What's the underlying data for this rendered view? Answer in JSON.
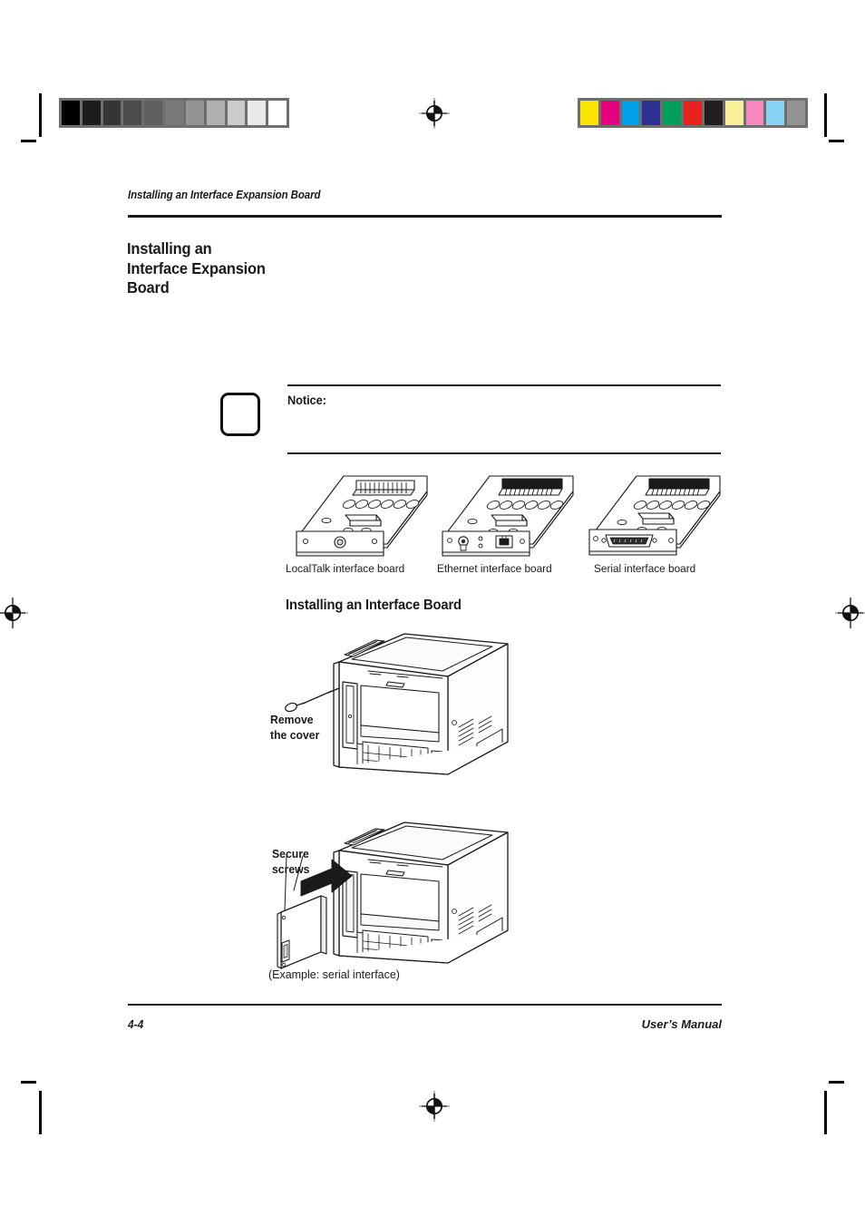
{
  "page": {
    "running_head": "Installing an Interface Expansion Board",
    "chapter_title": "Installing an Interface Expansion Board",
    "folio": "4-4",
    "manual_name": "User’s Manual"
  },
  "notice": {
    "label": "Notice:",
    "body": "",
    "icon": "notice-box-icon"
  },
  "boards": {
    "items": [
      {
        "caption": "LocalTalk interface board",
        "icon": "localtalk-board-illustration"
      },
      {
        "caption": "Ethernet interface board",
        "icon": "ethernet-board-illustration"
      },
      {
        "caption": "Serial interface board",
        "icon": "serial-board-illustration"
      }
    ]
  },
  "section": {
    "heading": "Installing an Interface Board"
  },
  "figures": {
    "step1": {
      "callout": "Remove\nthe cover",
      "callout_line1": "Remove",
      "callout_line2": "the cover",
      "icon": "printer-remove-cover-illustration"
    },
    "step2": {
      "callout_line1": "Secure",
      "callout_line2": "screws",
      "note": "(Example: serial interface)",
      "icon": "printer-insert-board-illustration"
    }
  },
  "calibration": {
    "gray_strip": {
      "name": "grayscale-step-wedge",
      "patches": [
        "#000000",
        "#1d1d1d",
        "#353535",
        "#4c4c4c",
        "#606060",
        "#787878",
        "#949494",
        "#b0b0b0",
        "#cbcbcb",
        "#e9e9e9",
        "#ffffff"
      ]
    },
    "color_strip": {
      "name": "color-control-bar",
      "patches": [
        "#fbe400",
        "#e4007f",
        "#00a0e9",
        "#2e3192",
        "#00a05a",
        "#e8231f",
        "#231f20",
        "#faf09a",
        "#f589bd",
        "#86d3f5",
        "#949494"
      ]
    },
    "registration_marks": [
      "top-center",
      "left-middle",
      "right-middle",
      "bottom-center"
    ]
  }
}
